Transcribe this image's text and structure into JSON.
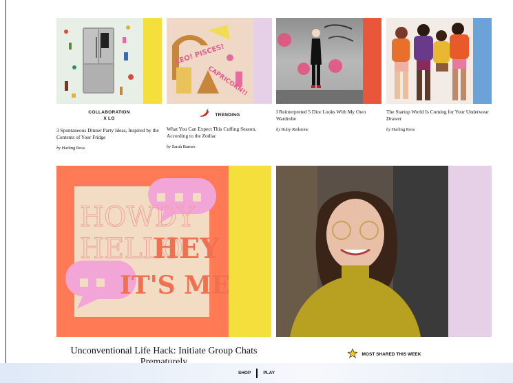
{
  "cards": [
    {
      "tag_line1": "COLLABORATION",
      "tag_line2": "X LG",
      "title": "3 Spontaneous Dinner Party Ideas, Inspired by the Contents of Your Fridge",
      "author_prefix": "by",
      "author": "Harling Ross",
      "strip_color": "#f5df3c",
      "image_desc": "fridge-illustration"
    },
    {
      "tag": "TRENDING",
      "tag_icon": "chili-pepper-icon",
      "title": "What You Can Expect This Cuffing Season, According to the Zodiac",
      "author_prefix": "by",
      "author": "Sarah Barnes",
      "strip_color": "#e6d0e8",
      "image_text_1": "LEO! PISCES!",
      "image_text_2": "CAPRICORN!!"
    },
    {
      "title": "I Reinterpreted 5 Dior Looks With My Own Wardrobe",
      "author_prefix": "by",
      "author": "Ruby Redstone",
      "strip_color": "#e8573a"
    },
    {
      "title": "The Startup World Is Coming for Your Underwear Drawer",
      "author_prefix": "by",
      "author": "Harling Ross",
      "strip_color": "#6ba3d8"
    }
  ],
  "feature": {
    "art_words": [
      "HOWDY",
      "HELLO",
      "HEY",
      "IT'S ME"
    ],
    "title": "Unconventional Life Hack: Initiate Group Chats Prematurely",
    "left_strip_color": "#f5df3c",
    "right_strip_color": "#e6d0e8"
  },
  "most_shared": {
    "label": "MOST SHARED THIS WEEK",
    "icon": "star-icon"
  },
  "bottom_bar": {
    "shop": "SHOP",
    "play": "PLAY"
  }
}
